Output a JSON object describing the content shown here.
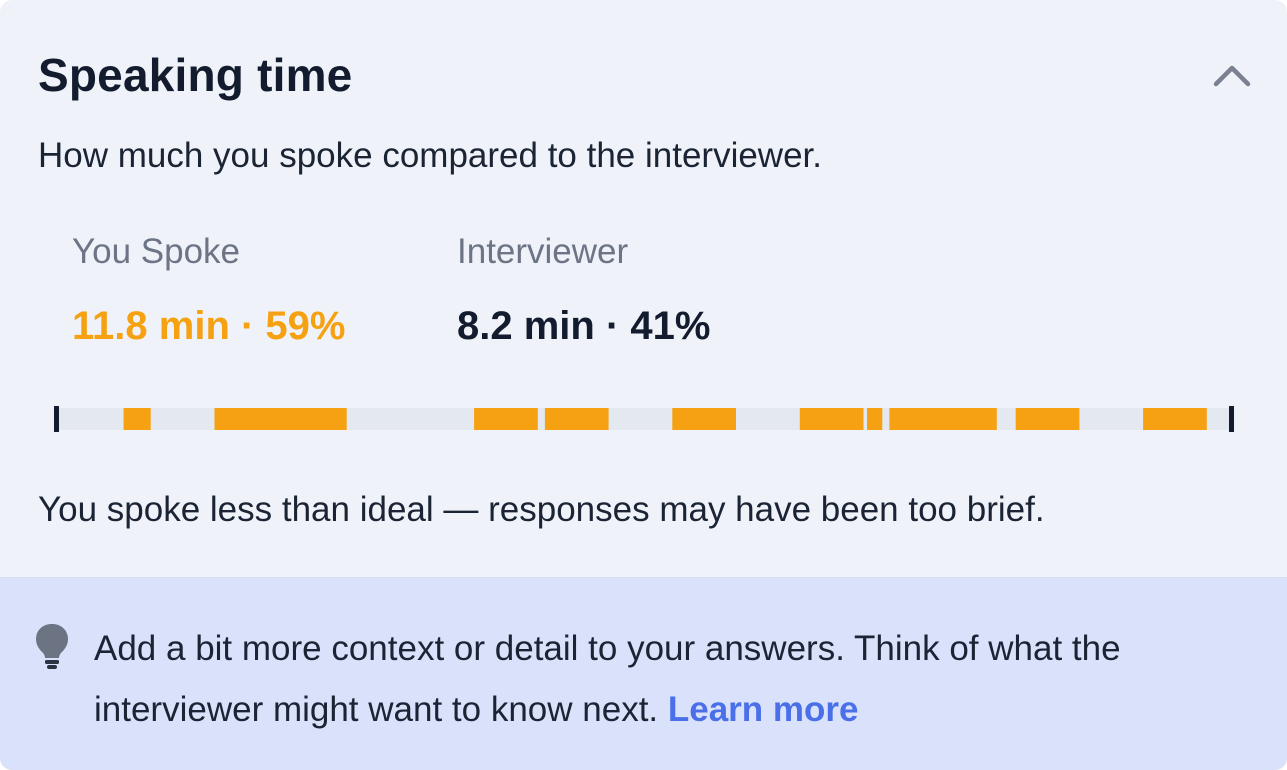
{
  "card": {
    "title": "Speaking time",
    "subtitle": "How much you spoke compared to the interviewer.",
    "collapse_icon": "chevron-up-icon"
  },
  "stats": {
    "you": {
      "label": "You Spoke",
      "value": "11.8 min · 59%"
    },
    "interviewer": {
      "label": "Interviewer",
      "value": "8.2 min · 41%"
    }
  },
  "timeline": {
    "you_color": "#f5a112",
    "track_color": "#e3e8f1",
    "marker_color": "#131c2e",
    "you_segments": [
      [
        0.059,
        0.082
      ],
      [
        0.136,
        0.248
      ],
      [
        0.356,
        0.41
      ],
      [
        0.416,
        0.47
      ],
      [
        0.524,
        0.578
      ],
      [
        0.632,
        0.686
      ],
      [
        0.689,
        0.702
      ],
      [
        0.708,
        0.799
      ],
      [
        0.815,
        0.869
      ],
      [
        0.923,
        0.977
      ]
    ]
  },
  "message": "You spoke less than ideal — responses may have been too brief.",
  "tip": {
    "icon": "lightbulb-icon",
    "text": "Add a bit more context or detail to your answers. Think of what the interviewer might want to know next.",
    "link": "Learn more"
  },
  "colors": {
    "accent": "#f5a112",
    "link": "#4a6fe8",
    "tip_background": "#dae2fb",
    "card_background": "#eff3f9"
  }
}
